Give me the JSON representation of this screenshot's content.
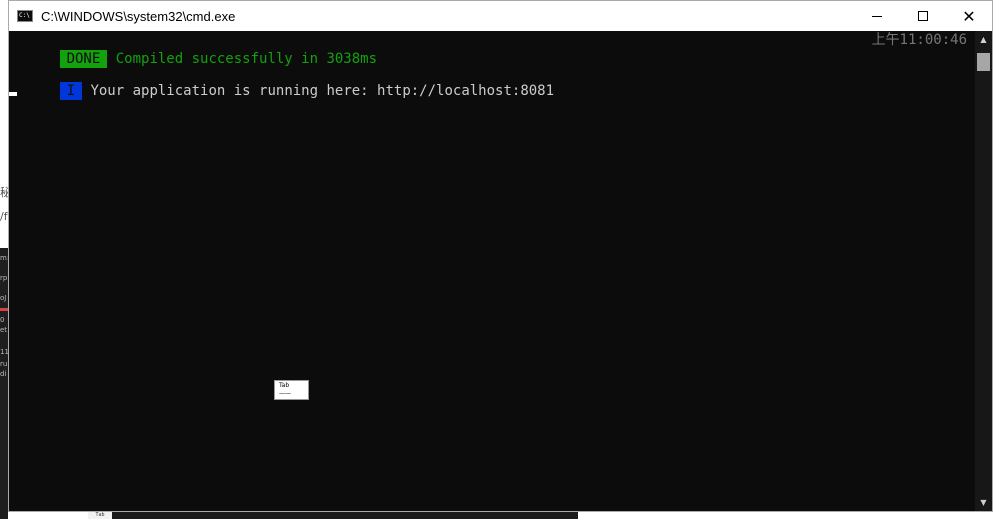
{
  "background": {
    "left_texts": [
      "秘",
      "/f",
      "m:",
      "rp",
      "oJ",
      "0",
      "et",
      "11",
      "ru",
      "di"
    ],
    "chip_label": "Tab"
  },
  "window": {
    "title": "C:\\WINDOWS\\system32\\cmd.exe",
    "icon_label": "C:\\",
    "controls": {
      "close_glyph": "✕"
    }
  },
  "console": {
    "done_label": "DONE",
    "compiled_message": "Compiled successfully in 3038ms",
    "timestamp": "上午11:00:46",
    "info_label": "I",
    "running_message": "Your application is running here: http://localhost:8081"
  },
  "scrollbar": {
    "up_glyph": "▲",
    "down_glyph": "▼"
  },
  "popup": {
    "line1": "Tab",
    "line2": "——"
  },
  "colors": {
    "console_bg": "#0c0c0c",
    "done_green": "#13a10e",
    "info_blue": "#0037da",
    "text_gray": "#cccccc"
  }
}
